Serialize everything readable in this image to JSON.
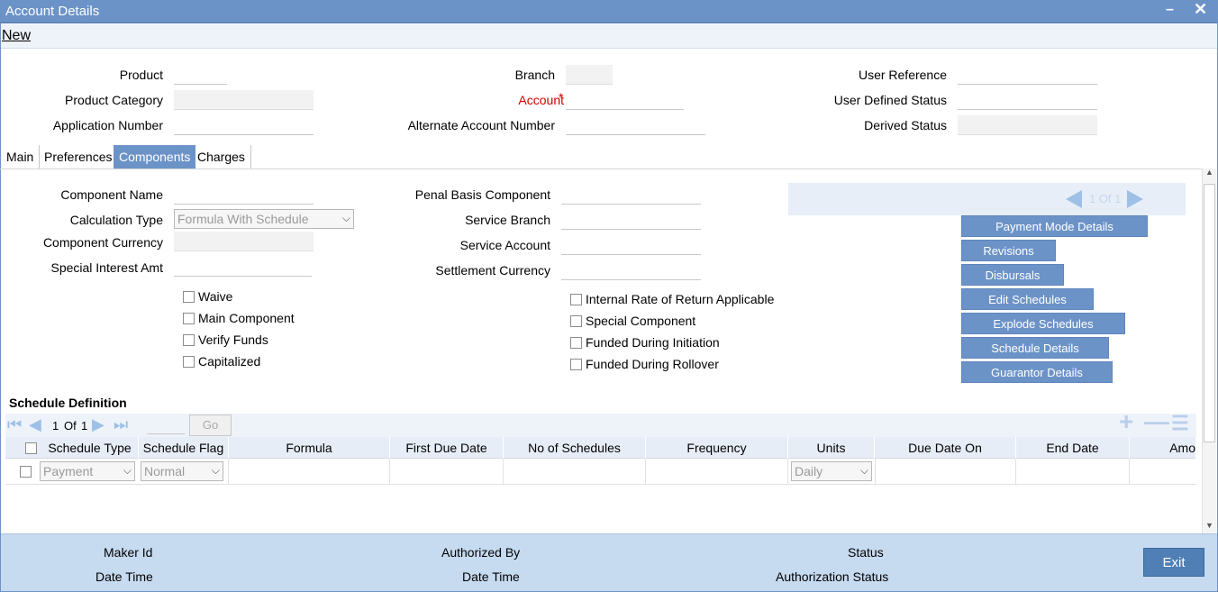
{
  "window": {
    "title": "Account Details"
  },
  "menu": {
    "new_label": "New"
  },
  "header": {
    "product_label": "Product",
    "product_category_label": "Product Category",
    "application_number_label": "Application Number",
    "branch_label": "Branch",
    "account_label": "Account",
    "account_required": "*",
    "alternate_account_label": "Alternate Account Number",
    "user_reference_label": "User Reference",
    "user_defined_status_label": "User Defined Status",
    "derived_status_label": "Derived Status"
  },
  "tabs": [
    {
      "label": "Main"
    },
    {
      "label": "Preferences"
    },
    {
      "label": "Components"
    },
    {
      "label": "Charges"
    }
  ],
  "components": {
    "component_name_label": "Component Name",
    "calculation_type_label": "Calculation Type",
    "calculation_type_value": "Formula With Schedule",
    "component_currency_label": "Component Currency",
    "special_interest_label": "Special Interest Amt",
    "penal_basis_label": "Penal Basis Component",
    "service_branch_label": "Service Branch",
    "service_account_label": "Service Account",
    "settlement_currency_label": "Settlement Currency",
    "checkboxes_left": [
      "Waive",
      "Main Component",
      "Verify Funds",
      "Capitalized"
    ],
    "checkboxes_right": [
      "Internal Rate of Return Applicable",
      "Special Component",
      "Funded During Initiation",
      "Funded During Rollover"
    ],
    "pager_text": "1 Of 1"
  },
  "side_buttons": [
    "Payment Mode Details",
    "Revisions",
    "Disbursals",
    "Edit Schedules",
    "Explode Schedules",
    "Schedule Details",
    "Guarantor Details"
  ],
  "schedule": {
    "title": "Schedule Definition",
    "page_current": "1",
    "page_of": "Of",
    "page_total": "1",
    "go_label": "Go",
    "columns": [
      "Schedule Type",
      "Schedule Flag",
      "Formula",
      "First Due Date",
      "No of Schedules",
      "Frequency",
      "Units",
      "Due Date On",
      "End Date",
      "Amo"
    ],
    "row": {
      "schedule_type": "Payment",
      "schedule_flag": "Normal",
      "units": "Daily"
    }
  },
  "footer": {
    "maker_id_label": "Maker Id",
    "date_time_label": "Date Time",
    "authorized_by_label": "Authorized By",
    "date_time2_label": "Date Time",
    "status_label": "Status",
    "authorization_status_label": "Authorization Status",
    "exit_label": "Exit"
  },
  "colors": {
    "accent": "#6c93c8",
    "footer": "#c6daf0",
    "required": "#cc0000"
  }
}
